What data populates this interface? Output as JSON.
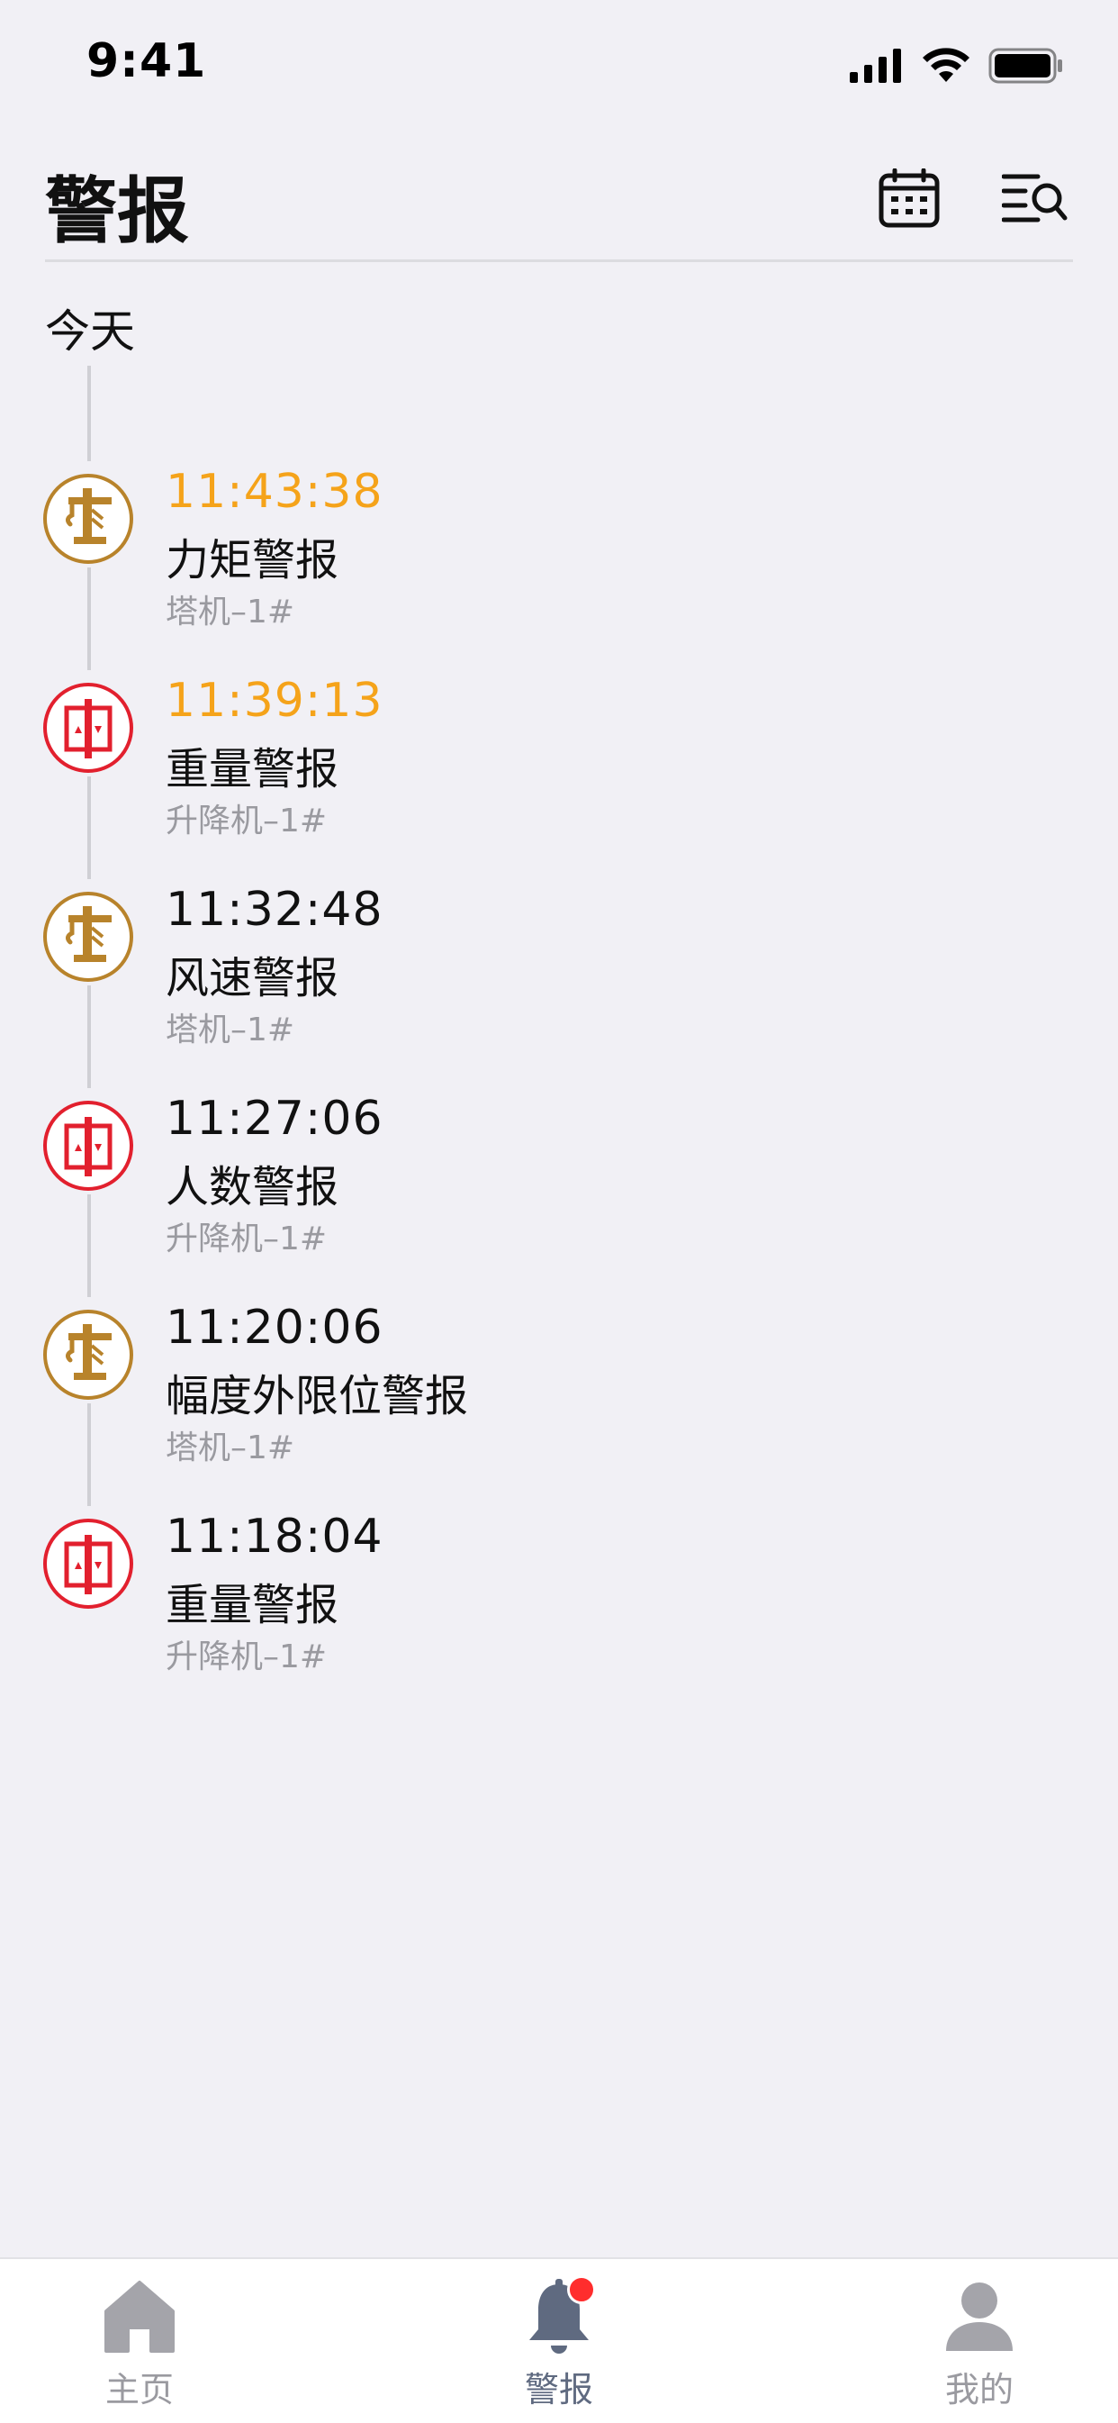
{
  "status_bar": {
    "time": "9:41"
  },
  "header": {
    "title": "警报",
    "calendar_icon": "calendar-icon",
    "filter_icon": "filter-search-icon"
  },
  "section": {
    "label": "今天"
  },
  "alerts": [
    {
      "time": "11:43:38",
      "type": "力矩警报",
      "device": "塔机–1#",
      "device_kind": "crane",
      "unread": true
    },
    {
      "time": "11:39:13",
      "type": "重量警报",
      "device": "升降机–1#",
      "device_kind": "hoist",
      "unread": true
    },
    {
      "time": "11:32:48",
      "type": "风速警报",
      "device": "塔机–1#",
      "device_kind": "crane",
      "unread": false
    },
    {
      "time": "11:27:06",
      "type": "人数警报",
      "device": "升降机–1#",
      "device_kind": "hoist",
      "unread": false
    },
    {
      "time": "11:20:06",
      "type": "幅度外限位警报",
      "device": "塔机–1#",
      "device_kind": "crane",
      "unread": false
    },
    {
      "time": "11:18:04",
      "type": "重量警报",
      "device": "升降机–1#",
      "device_kind": "hoist",
      "unread": false
    }
  ],
  "tab_bar": {
    "tabs": [
      {
        "label": "主页",
        "icon": "home-icon",
        "active": false
      },
      {
        "label": "警报",
        "icon": "bell-icon",
        "active": true,
        "badge": true
      },
      {
        "label": "我的",
        "icon": "person-icon",
        "active": false
      }
    ]
  },
  "colors": {
    "background": "#f1f0f5",
    "unread_time": "#f5a31a",
    "crane": "#b8832b",
    "hoist": "#e2202e",
    "badge": "#ff2d2d",
    "tab_active": "#5f6a80",
    "tab_inactive": "#9a9aa0"
  }
}
